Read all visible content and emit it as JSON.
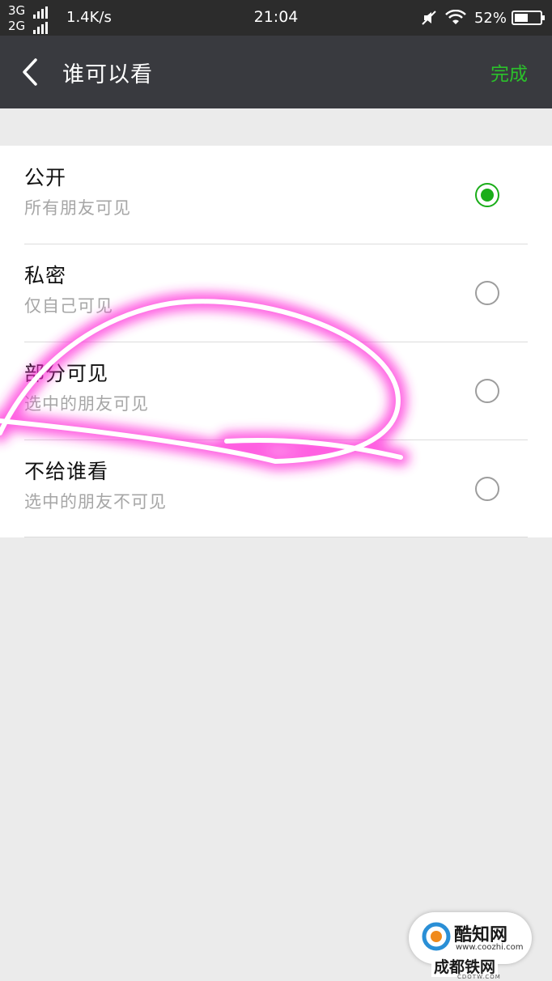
{
  "status_bar": {
    "signal_1": "3G",
    "signal_2": "2G",
    "net_speed": "1.4K/s",
    "time": "21:04",
    "battery": "52%",
    "battery_level": 0.52,
    "icons": [
      "mute-icon",
      "wifi-icon",
      "battery-icon"
    ]
  },
  "app_bar": {
    "title": "谁可以看",
    "done_label": "完成",
    "done_color": "#2bc12b",
    "background": "#393a3f"
  },
  "options": [
    {
      "title": "公开",
      "subtitle": "所有朋友可见",
      "selected": true
    },
    {
      "title": "私密",
      "subtitle": "仅自己可见",
      "selected": false
    },
    {
      "title": "部分可见",
      "subtitle": "选中的朋友可见",
      "selected": false
    },
    {
      "title": "不给谁看",
      "subtitle": "选中的朋友不可见",
      "selected": false
    }
  ],
  "accent_color": "#1aad19",
  "watermark": {
    "name": "酷知网",
    "url": "www.coozhi.com",
    "site": "成都铁网",
    "site_sub": "CDOTW.COM"
  }
}
